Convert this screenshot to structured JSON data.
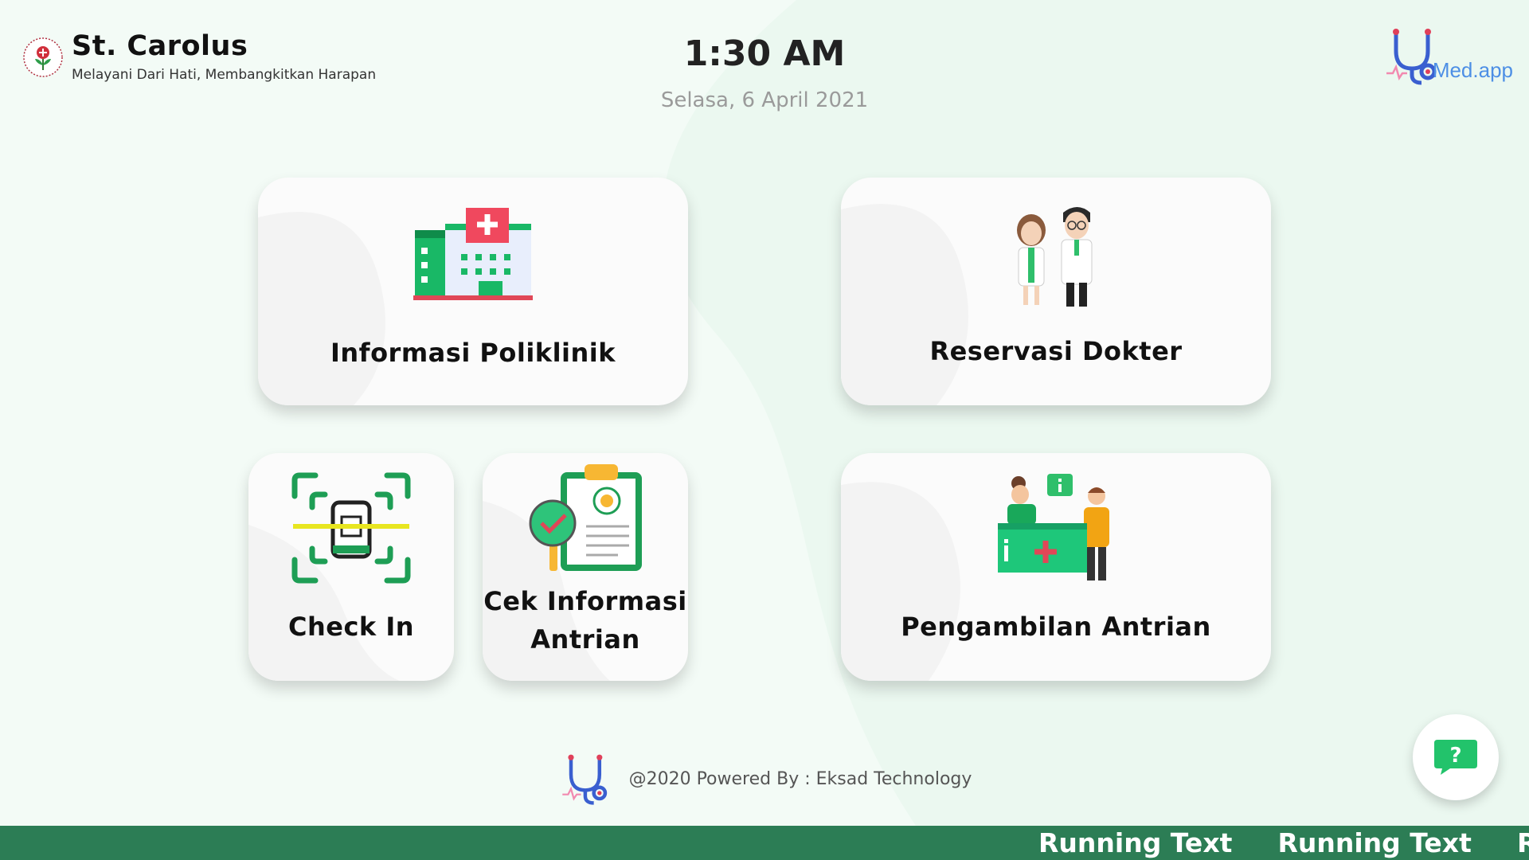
{
  "brand": {
    "name": "St. Carolus",
    "tagline": "Melayani Dari Hati, Membangkitkan Harapan"
  },
  "clock": {
    "time": "1:30 AM",
    "date": "Selasa, 6 April 2021"
  },
  "partner_logo": {
    "text": "Med.app",
    "icon": "stethoscope-icon"
  },
  "menu": {
    "info_poliklinik": {
      "label": "Informasi Poliklinik",
      "icon": "hospital-icon"
    },
    "reservasi_dokter": {
      "label": "Reservasi Dokter",
      "icon": "doctors-icon"
    },
    "check_in": {
      "label": "Check In",
      "icon": "scan-phone-icon"
    },
    "cek_antrian": {
      "label_line1": "Cek Informasi",
      "label_line2": "Antrian",
      "icon": "clipboard-check-icon"
    },
    "pengambilan_antrian": {
      "label": "Pengambilan Antrian",
      "icon": "reception-desk-icon"
    }
  },
  "footer": {
    "text": "@2020 Powered By : Eksad Technology"
  },
  "help_button": {
    "icon": "help-chat-icon",
    "label": "?"
  },
  "ticker": {
    "items": [
      "Running Text",
      "Running Text",
      "Runni"
    ]
  },
  "colors": {
    "background": "#f3fbf6",
    "ticker_bar": "#2c7d55",
    "accent_green": "#20c36b",
    "accent_blue": "#4d8fe5"
  }
}
